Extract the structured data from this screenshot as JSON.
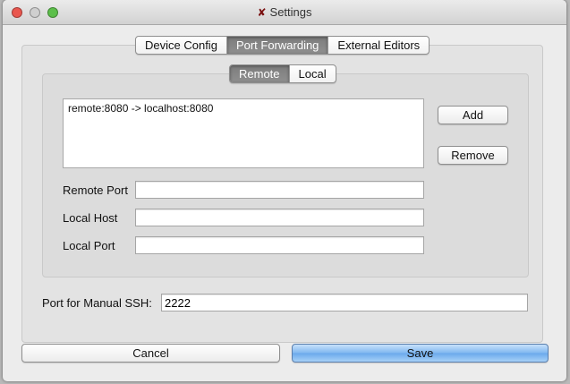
{
  "window": {
    "title": "Settings"
  },
  "tabs": [
    {
      "label": "Device Config",
      "selected": false
    },
    {
      "label": "Port Forwarding",
      "selected": true
    },
    {
      "label": "External Editors",
      "selected": false
    }
  ],
  "subtabs": [
    {
      "label": "Remote",
      "selected": true
    },
    {
      "label": "Local",
      "selected": false
    }
  ],
  "forwards": [
    "remote:8080 -> localhost:8080"
  ],
  "buttons": {
    "add": "Add",
    "remove": "Remove",
    "cancel": "Cancel",
    "save": "Save"
  },
  "fields": {
    "remote_port": {
      "label": "Remote Port",
      "value": ""
    },
    "local_host": {
      "label": "Local Host",
      "value": ""
    },
    "local_port": {
      "label": "Local Port",
      "value": ""
    },
    "ssh_port": {
      "label": "Port for Manual SSH:",
      "value": "2222"
    }
  }
}
